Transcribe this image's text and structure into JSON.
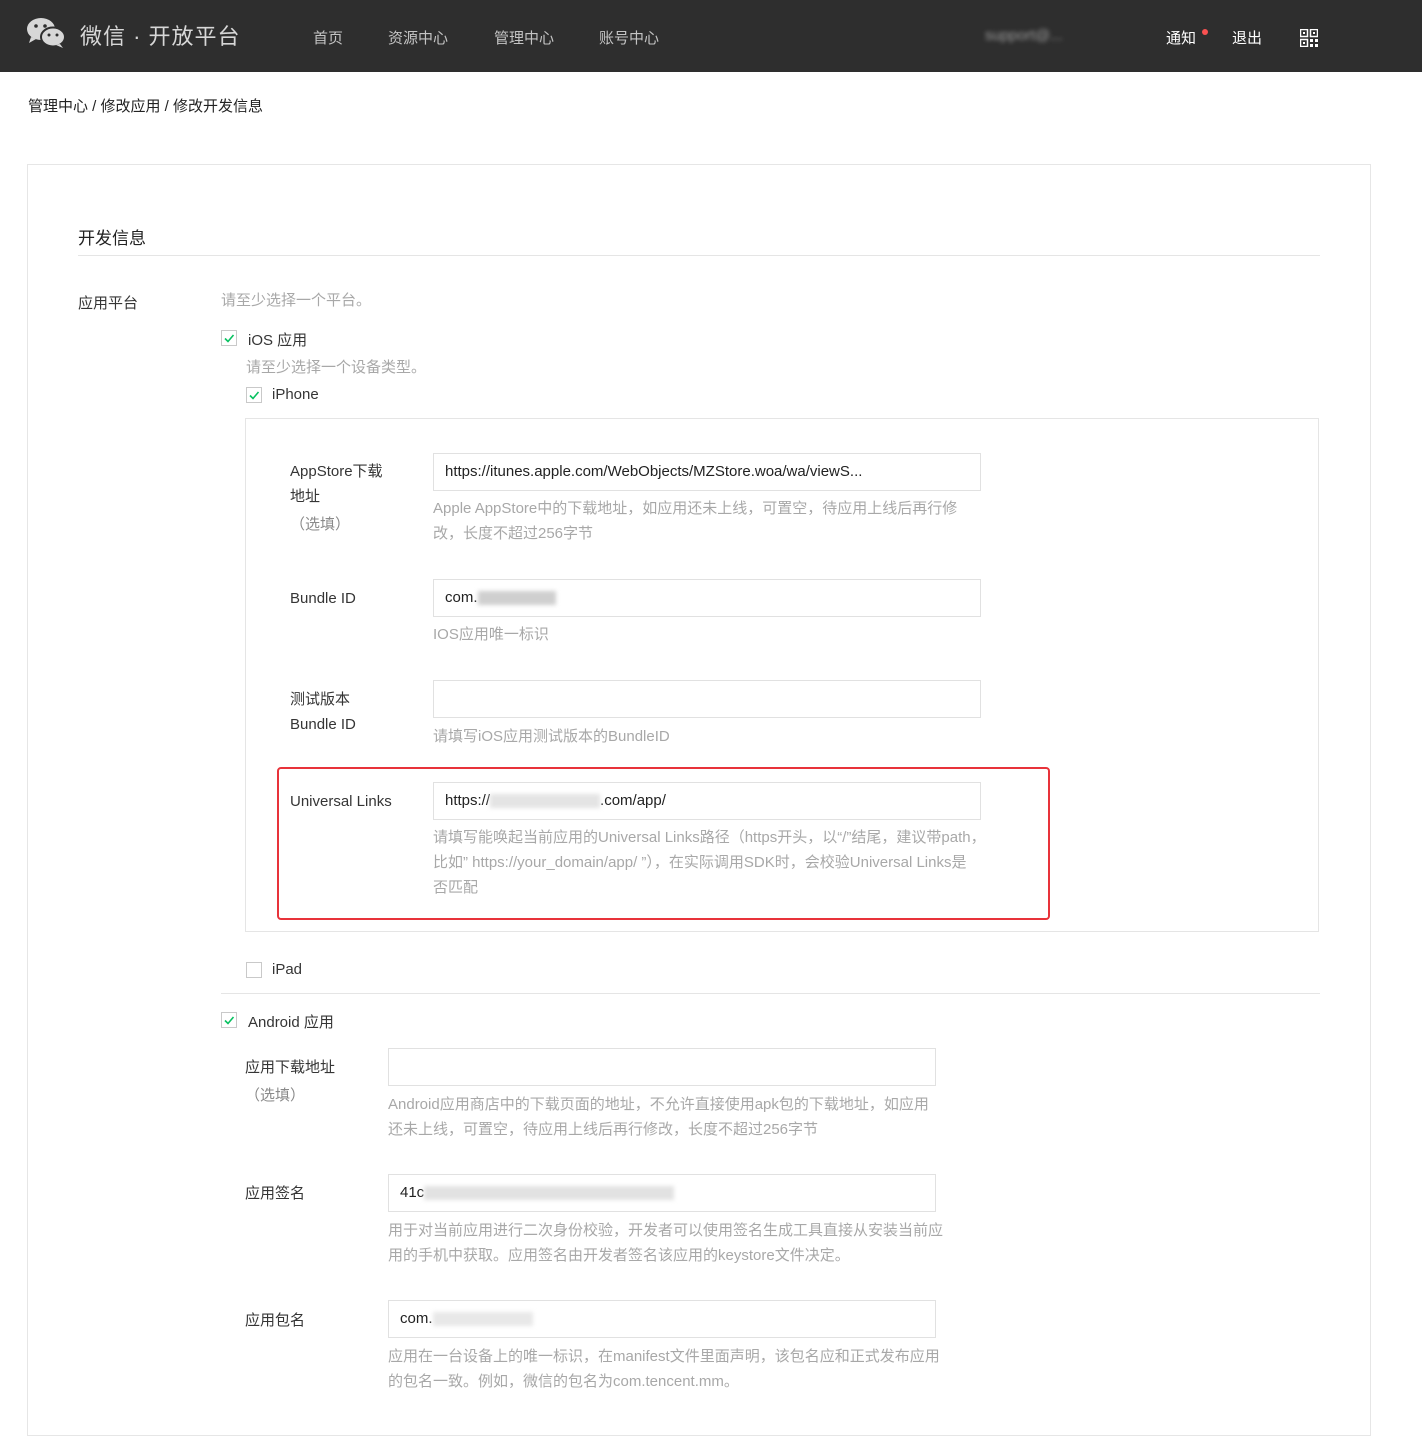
{
  "header": {
    "logo_text": "微信 · 开放平台",
    "nav": [
      "首页",
      "资源中心",
      "管理中心",
      "账号中心"
    ],
    "account": "support@...",
    "notice": "通知",
    "logout": "退出"
  },
  "breadcrumb": "管理中心 / 修改应用 / 修改开发信息",
  "section_title": "开发信息",
  "platform": {
    "label": "应用平台",
    "hint": "请至少选择一个平台。"
  },
  "ios": {
    "checkbox_label": "iOS 应用",
    "checked": true,
    "device_hint": "请至少选择一个设备类型。",
    "iphone_label": "iPhone",
    "iphone_checked": true,
    "appstore": {
      "label_line1": "AppStore下载",
      "label_line2": "地址",
      "optional": "（选填）",
      "value": "https://itunes.apple.com/WebObjects/MZStore.woa/wa/viewS...",
      "hint_line1": "Apple AppStore中的下载地址，如应用还未上线，可置空，待应用上线后再行修",
      "hint_line2": "改，长度不超过256字节"
    },
    "bundle": {
      "label": "Bundle ID",
      "value_prefix": "com.",
      "hint": "IOS应用唯一标识"
    },
    "test_bundle": {
      "label_line1": "测试版本",
      "label_line2": "Bundle ID",
      "value": "",
      "hint": "请填写iOS应用测试版本的BundleID"
    },
    "universal_links": {
      "label": "Universal Links",
      "value_prefix": "https://",
      "value_suffix": ".com/app/",
      "hint_line1": "请填写能唤起当前应用的Universal Links路径（https开头，以“/”结尾，建议带path，",
      "hint_line2": "比如” https://your_domain/app/ ”），在实际调用SDK时，会校验Universal Links是",
      "hint_line3": "否匹配"
    },
    "ipad_label": "iPad",
    "ipad_checked": false
  },
  "android": {
    "checkbox_label": "Android 应用",
    "checked": true,
    "download": {
      "label": "应用下载地址",
      "optional": "（选填）",
      "value": "",
      "hint_line1": "Android应用商店中的下载页面的地址，不允许直接使用apk包的下载地址，如应用",
      "hint_line2": "还未上线，可置空，待应用上线后再行修改，长度不超过256字节"
    },
    "signature": {
      "label": "应用签名",
      "value_prefix": "41c",
      "hint_line1": "用于对当前应用进行二次身份校验，开发者可以使用签名生成工具直接从安装当前应",
      "hint_line2": "用的手机中获取。应用签名由开发者签名该应用的keystore文件决定。"
    },
    "package": {
      "label": "应用包名",
      "value_prefix": "com.",
      "hint_line1": "应用在一台设备上的唯一标识，在manifest文件里面声明，该包名应和正式发布应用",
      "hint_line2": "的包名一致。例如，微信的包名为com.tencent.mm。"
    }
  },
  "colors": {
    "topbar": "#2e2e2e",
    "checkmark": "#07c160",
    "highlight": "#e8333a"
  }
}
